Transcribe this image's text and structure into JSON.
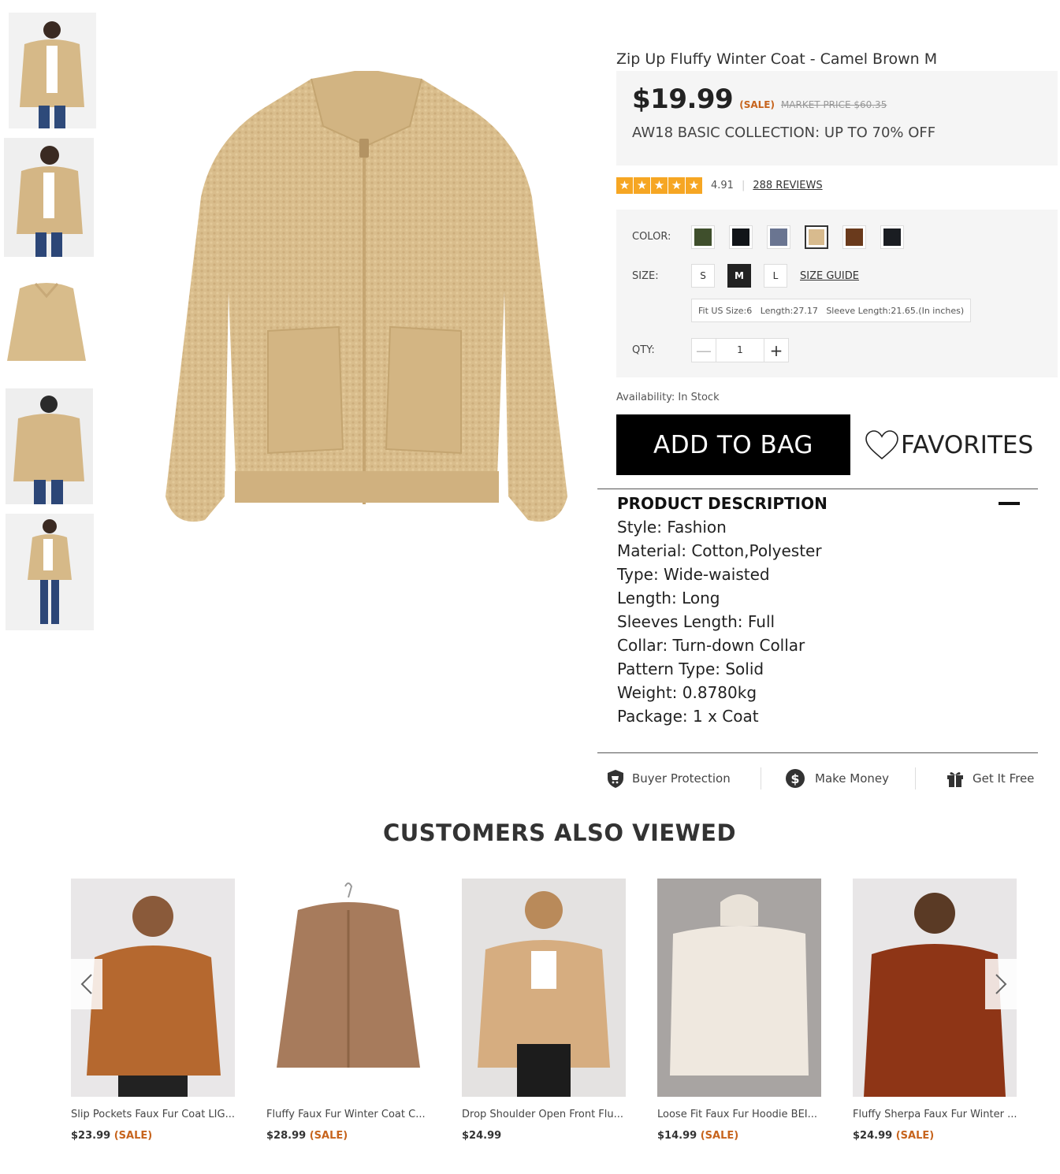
{
  "product": {
    "title": "Zip Up Fluffy Winter Coat - Camel Brown M",
    "price": "$19.99",
    "sale_tag": "(SALE)",
    "market_price": "MARKET PRICE $60.35",
    "promo": "AW18 BASIC COLLECTION: UP TO 70% OFF",
    "rating": "4.91",
    "reviews": "288 REVIEWS",
    "star_color": "#f6a623"
  },
  "options": {
    "color_label": "COLOR:",
    "colors": [
      "#3f4f2c",
      "#111418",
      "#6a7591",
      "#d8bb8e",
      "#6a3a1c",
      "#1a1d22"
    ],
    "selected_color_index": 3,
    "size_label": "SIZE:",
    "sizes": [
      "S",
      "M",
      "L"
    ],
    "selected_size": "M",
    "size_guide": "SIZE GUIDE",
    "fit_info": "Fit US Size:6   Length:27.17   Sleeve Length:21.65.(In inches)",
    "qty_label": "QTY:",
    "qty_value": "1",
    "minus": "—",
    "plus": "+"
  },
  "availability": "Availability: In Stock",
  "actions": {
    "add_to_bag": "ADD TO BAG",
    "favorites": "FAVORITES"
  },
  "description": {
    "title": "PRODUCT DESCRIPTION",
    "lines": [
      "Style: Fashion",
      "Material: Cotton,Polyester",
      "Type: Wide-waisted",
      "Length: Long",
      "Sleeves Length: Full",
      "Collar: Turn-down Collar",
      "Pattern Type: Solid",
      "Weight: 0.8780kg",
      "Package: 1 x Coat"
    ]
  },
  "perks": {
    "buyer_protection": "Buyer Protection",
    "make_money": "Make Money",
    "get_it_free": "Get It Free"
  },
  "also_viewed": {
    "title": "CUSTOMERS ALSO VIEWED",
    "items": [
      {
        "name": "Slip Pockets Faux Fur Coat LIG...",
        "price": "$23.99",
        "sale": "(SALE)",
        "color": "#b5682f"
      },
      {
        "name": "Fluffy Faux Fur Winter Coat C...",
        "price": "$28.99",
        "sale": "(SALE)",
        "color": "#a77b5c"
      },
      {
        "name": "Drop Shoulder Open Front Flu...",
        "price": "$24.99",
        "sale": "",
        "color": "#d6ad80"
      },
      {
        "name": "Loose Fit Faux Fur Hoodie BEI...",
        "price": "$14.99",
        "sale": "(SALE)",
        "color": "#efe8df"
      },
      {
        "name": "Fluffy Sherpa Faux Fur Winter ...",
        "price": "$24.99",
        "sale": "(SALE)",
        "color": "#8e3516"
      }
    ]
  },
  "colors": {
    "coat": "#d9bd8c",
    "sale": "#c7641d",
    "panel_bg": "#f5f5f5"
  }
}
